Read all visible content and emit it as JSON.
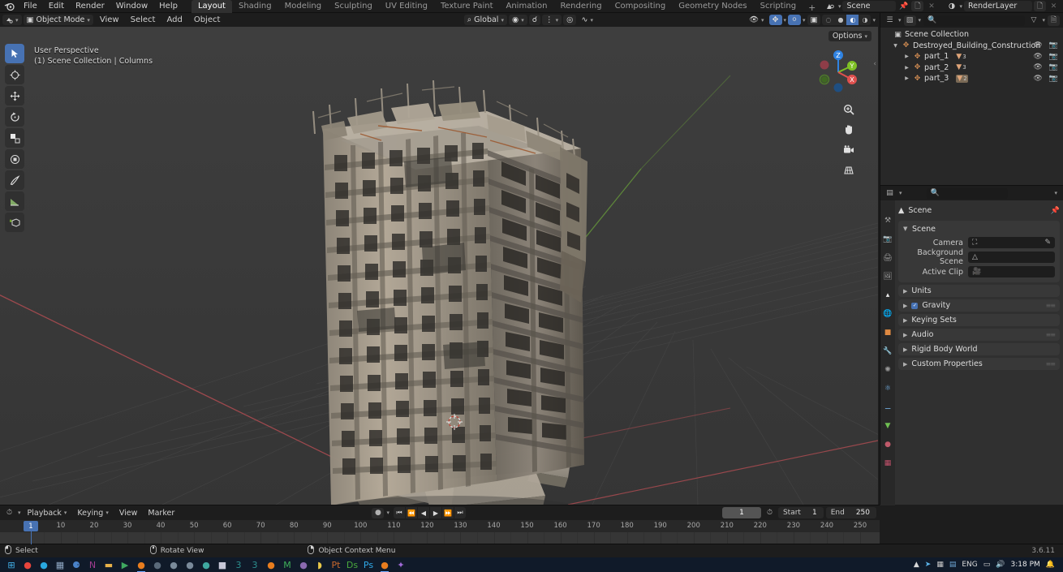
{
  "app": {
    "name": "Blender",
    "version": "3.6.11",
    "logo_icon": "blender-logo"
  },
  "topbar": {
    "menus": [
      "File",
      "Edit",
      "Render",
      "Window",
      "Help"
    ],
    "workspace_tabs": [
      {
        "label": "Layout",
        "active": true
      },
      {
        "label": "Shading",
        "active": false
      },
      {
        "label": "Modeling",
        "active": false
      },
      {
        "label": "Sculpting",
        "active": false
      },
      {
        "label": "UV Editing",
        "active": false
      },
      {
        "label": "Texture Paint",
        "active": false
      },
      {
        "label": "Animation",
        "active": false
      },
      {
        "label": "Rendering",
        "active": false
      },
      {
        "label": "Compositing",
        "active": false
      },
      {
        "label": "Geometry Nodes",
        "active": false
      },
      {
        "label": "Scripting",
        "active": false
      }
    ],
    "add_workspace_label": "+",
    "scene_name": "Scene",
    "view_layer_name": "RenderLayer",
    "scene_icon": "scene-icon",
    "view_layer_icon": "view-layer-icon",
    "pin_icon": "pin-icon",
    "new_scene_icon": "copy-icon",
    "remove_scene_icon": "close-icon"
  },
  "viewport": {
    "editor_type_icon": "editor-type-icon",
    "mode": "Object Mode",
    "mode_icon": "object-mode-icon",
    "menus": [
      "View",
      "Select",
      "Add",
      "Object"
    ],
    "select_modes": [
      "tweak",
      "select-box",
      "select-circle",
      "select-lasso",
      "select-extend"
    ],
    "transform_orientation": "Global",
    "transform_icon": "orientation-icon",
    "pivot_icon": "pivot-point-icon",
    "snap_icon": "snap-magnet-icon",
    "snap_to_icon": "snap-increment-icon",
    "proportional_icon": "proportional-edit-icon",
    "proportional_falloff_icon": "falloff-curve-icon",
    "visibility_icon": "object-types-visibility-icon",
    "gizmo_icon": "gizmo-icon",
    "overlays_icon": "overlays-icon",
    "xray_icon": "xray-toggle-icon",
    "shading_modes": [
      "wireframe",
      "solid",
      "material-preview",
      "rendered"
    ],
    "active_shading_mode": "material-preview",
    "options_label": "Options",
    "overlay_line1": "User Perspective",
    "overlay_line2": "(1) Scene Collection | Columns",
    "toolbar": [
      {
        "name": "tweak-select-box-tool",
        "icon": "cursor-arrow",
        "active": true
      },
      {
        "name": "cursor-tool",
        "icon": "crosshair"
      },
      {
        "name": "move-tool",
        "icon": "move-arrows"
      },
      {
        "name": "rotate-tool",
        "icon": "rotate"
      },
      {
        "name": "scale-tool",
        "icon": "scale"
      },
      {
        "name": "transform-tool",
        "icon": "transform"
      },
      {
        "name": "annotate-tool",
        "icon": "pencil"
      },
      {
        "name": "measure-tool",
        "icon": "ruler"
      },
      {
        "name": "add-cube-tool",
        "icon": "add-cube"
      }
    ],
    "gizmo_axes": [
      {
        "label": "Z",
        "color": "#2f83e3"
      },
      {
        "label": "Y",
        "color": "#7fc125"
      },
      {
        "label": "X",
        "color": "#e0504e"
      }
    ],
    "nav_buttons": [
      {
        "name": "zoom-view-button",
        "icon": "magnifier"
      },
      {
        "name": "pan-view-button",
        "icon": "hand"
      },
      {
        "name": "camera-view-button",
        "icon": "camera"
      },
      {
        "name": "toggle-perspective-button",
        "icon": "grid-perspective"
      }
    ],
    "model_description": "Destroyed concrete high-rise building construction 3D model"
  },
  "outliner": {
    "display_mode_icon": "outliner-display-mode-icon",
    "filter_id_icon": "filter-id-icon",
    "search_placeholder": "",
    "search_value": "",
    "filter_icon": "filter-funnel-icon",
    "new_collection_icon": "new-collection-icon",
    "rows": [
      {
        "label": "Scene Collection",
        "icon": "scene-collection-icon",
        "indent": 0,
        "expandable": false,
        "mesh_count": null,
        "eye": false,
        "camera": false
      },
      {
        "label": "Destroyed_Building_Construction",
        "icon": "empty-axes-icon",
        "indent": 1,
        "expandable": true,
        "expanded": true,
        "mesh_count": null,
        "eye": true,
        "camera": true
      },
      {
        "label": "part_1",
        "icon": "empty-axes-icon",
        "indent": 2,
        "expandable": true,
        "expanded": false,
        "mesh_count": "3",
        "eye": true,
        "camera": true
      },
      {
        "label": "part_2",
        "icon": "empty-axes-icon",
        "indent": 2,
        "expandable": true,
        "expanded": false,
        "mesh_count": "3",
        "eye": true,
        "camera": true
      },
      {
        "label": "part_3",
        "icon": "empty-axes-icon",
        "indent": 2,
        "expandable": true,
        "expanded": false,
        "mesh_count": "2",
        "eye": true,
        "camera": true,
        "selected": true
      }
    ],
    "eye_icon": "eye-icon",
    "camera_icon": "camera-render-icon"
  },
  "properties": {
    "editor_icon": "properties-editor-icon",
    "search_placeholder": "",
    "dropdown_icon": "chevron-down-icon",
    "breadcrumb_icon": "scene-properties-icon",
    "breadcrumb_label": "Scene",
    "pin_icon": "pin-icon",
    "tabs": [
      {
        "name": "tool-tab",
        "icon": "wrench-screwdriver",
        "active": false
      },
      {
        "name": "render-tab",
        "icon": "camera-back",
        "active": false
      },
      {
        "name": "output-tab",
        "icon": "printer",
        "active": false
      },
      {
        "name": "view-layer-tab",
        "icon": "images",
        "active": false
      },
      {
        "name": "scene-tab",
        "icon": "cone-sphere",
        "active": true
      },
      {
        "name": "world-tab",
        "icon": "world-globe",
        "active": false
      },
      {
        "name": "object-tab",
        "icon": "orange-square",
        "active": false
      },
      {
        "name": "modifiers-tab",
        "icon": "wrench",
        "active": false
      },
      {
        "name": "particles-tab",
        "icon": "particles",
        "active": false
      },
      {
        "name": "physics-tab",
        "icon": "physics-orbit",
        "active": false
      },
      {
        "name": "constraints-tab",
        "icon": "constraint",
        "active": false
      },
      {
        "name": "data-tab",
        "icon": "green-triangle-data",
        "active": false
      },
      {
        "name": "material-tab",
        "icon": "material-sphere",
        "active": false
      },
      {
        "name": "texture-tab",
        "icon": "checker-texture",
        "active": false
      }
    ],
    "scene_panel": {
      "title": "Scene",
      "expanded": true,
      "rows": [
        {
          "label": "Camera",
          "value": "",
          "field_icon": "camera-data-icon",
          "has_eyedropper": true
        },
        {
          "label": "Background Scene",
          "value": "",
          "field_icon": "scene-data-icon",
          "has_eyedropper": false
        },
        {
          "label": "Active Clip",
          "value": "",
          "field_icon": "movie-clip-icon",
          "has_eyedropper": false
        }
      ]
    },
    "closed_panels": [
      {
        "label": "Units",
        "checkbox": false,
        "grip": false
      },
      {
        "label": "Gravity",
        "checkbox": true,
        "checked": true,
        "grip": true
      },
      {
        "label": "Keying Sets",
        "checkbox": false,
        "grip": false
      },
      {
        "label": "Audio",
        "checkbox": false,
        "grip": true
      },
      {
        "label": "Rigid Body World",
        "checkbox": false,
        "grip": false
      },
      {
        "label": "Custom Properties",
        "checkbox": false,
        "grip": true
      }
    ]
  },
  "timeline": {
    "editor_icon": "timeline-editor-icon",
    "menus": [
      "Playback",
      "Keying",
      "View",
      "Marker"
    ],
    "menus_with_chevron": [
      "Playback",
      "Keying"
    ],
    "auto_key_icon": "record-dot-icon",
    "playback_buttons": [
      {
        "name": "jump-to-start-button",
        "icon": "|<"
      },
      {
        "name": "jump-to-prev-keyframe-button",
        "icon": "<<"
      },
      {
        "name": "play-reverse-button",
        "icon": "<"
      },
      {
        "name": "play-button",
        "icon": ">"
      },
      {
        "name": "jump-to-next-keyframe-button",
        "icon": ">>"
      },
      {
        "name": "jump-to-end-button",
        "icon": ">|"
      }
    ],
    "current_frame": "1",
    "use_preview_range_icon": "stopwatch-icon",
    "start_label": "Start",
    "start_value": "1",
    "end_label": "End",
    "end_value": "250",
    "ruler_ticks": [
      "10",
      "20",
      "30",
      "40",
      "50",
      "60",
      "70",
      "80",
      "90",
      "100",
      "110",
      "120",
      "130",
      "140",
      "150",
      "160",
      "170",
      "180",
      "190",
      "200",
      "210",
      "220",
      "230",
      "240",
      "250"
    ],
    "playhead_frame": "1"
  },
  "statusbar": {
    "items": [
      {
        "icon": "mouse-left-button-icon",
        "label": "Select"
      },
      {
        "icon": "mouse-middle-button-icon",
        "label": "Rotate View"
      },
      {
        "icon": "mouse-right-button-icon",
        "label": "Object Context Menu"
      }
    ],
    "version": "3.6.11"
  },
  "taskbar": {
    "icons": [
      {
        "name": "start-button-icon",
        "glyph": "⊞",
        "color": "#41b0e8",
        "running": false
      },
      {
        "name": "chrome-icon",
        "glyph": "●",
        "color": "#e8453c",
        "running": false
      },
      {
        "name": "edge-icon",
        "glyph": "●",
        "color": "#29a8e0",
        "running": false
      },
      {
        "name": "calculator-icon",
        "glyph": "▦",
        "color": "#8fa8c4",
        "running": false
      },
      {
        "name": "steam-icon",
        "glyph": "⚈",
        "color": "#4a82c8",
        "running": false
      },
      {
        "name": "onenote-icon",
        "glyph": "N",
        "color": "#a03c8f",
        "running": false
      },
      {
        "name": "file-explorer-icon",
        "glyph": "▬",
        "color": "#e8b24a",
        "running": false
      },
      {
        "name": "terminal-icon",
        "glyph": "▶",
        "color": "#3fa860",
        "running": false
      },
      {
        "name": "blender-icon-1",
        "glyph": "●",
        "color": "#e87d1e",
        "running": true
      },
      {
        "name": "unknown-app-icon-1",
        "glyph": "●",
        "color": "#5a6a7a",
        "running": false
      },
      {
        "name": "unknown-app-icon-2",
        "glyph": "●",
        "color": "#7a8a9a",
        "running": false
      },
      {
        "name": "unknown-app-icon-3",
        "glyph": "●",
        "color": "#7a8a9a",
        "running": false
      },
      {
        "name": "unknown-app-icon-4",
        "glyph": "●",
        "color": "#3fa8a0",
        "running": false
      },
      {
        "name": "app-icon-5",
        "glyph": "■",
        "color": "#c8c8d8",
        "running": false
      },
      {
        "name": "max-icon-1",
        "glyph": "3",
        "color": "#2d8f8f",
        "running": false
      },
      {
        "name": "max-icon-2",
        "glyph": "3",
        "color": "#2d8f8f",
        "running": false
      },
      {
        "name": "blender-icon-2",
        "glyph": "●",
        "color": "#e87d1e",
        "running": false
      },
      {
        "name": "marmoset-icon",
        "glyph": "M",
        "color": "#3fb05a",
        "running": false
      },
      {
        "name": "media-player-icon",
        "glyph": "●",
        "color": "#8a6ab0",
        "running": false
      },
      {
        "name": "substance-icon",
        "glyph": "◗",
        "color": "#e8c84a",
        "running": false
      },
      {
        "name": "powerpoint-icon",
        "glyph": "Pt",
        "color": "#c8682c",
        "running": false
      },
      {
        "name": "designer-icon",
        "glyph": "Ds",
        "color": "#4aa83c",
        "running": false
      },
      {
        "name": "photoshop-icon",
        "glyph": "Ps",
        "color": "#2fa8e8",
        "running": false
      },
      {
        "name": "blender-icon-3",
        "glyph": "●",
        "color": "#e87d1e",
        "running": true
      },
      {
        "name": "visual-studio-icon",
        "glyph": "✦",
        "color": "#a06ad8",
        "running": false
      }
    ],
    "tray": [
      {
        "name": "show-hidden-icons-icon",
        "glyph": "▲"
      },
      {
        "name": "telegram-icon",
        "glyph": "➤"
      },
      {
        "name": "graphics-settings-icon",
        "glyph": "▦"
      },
      {
        "name": "network-adapter-icon",
        "glyph": "▤"
      },
      {
        "name": "language-indicator",
        "glyph": "ENG"
      },
      {
        "name": "battery-icon",
        "glyph": "▭"
      },
      {
        "name": "volume-icon",
        "glyph": "ᵔ"
      }
    ],
    "clock_time": "3:18 PM",
    "notifications_icon": "notifications-bell-icon"
  }
}
